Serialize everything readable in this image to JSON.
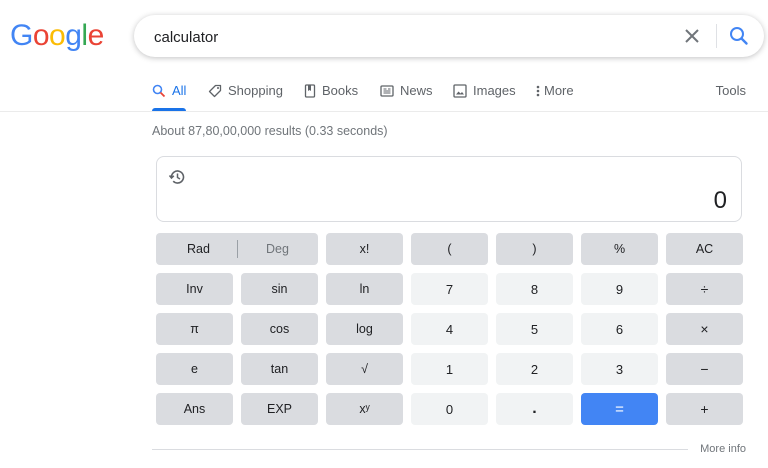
{
  "logo": {
    "letters": [
      "G",
      "o",
      "o",
      "g",
      "l",
      "e"
    ],
    "colors": [
      "#4285f4",
      "#ea4335",
      "#fbbc05",
      "#4285f4",
      "#34a853",
      "#ea4335"
    ]
  },
  "search": {
    "query": "calculator",
    "clear_icon": "close-icon",
    "search_icon": "search-icon"
  },
  "tabs": [
    {
      "label": "All",
      "icon": "search-icon"
    },
    {
      "label": "Shopping",
      "icon": "tag-icon"
    },
    {
      "label": "Books",
      "icon": "book-icon"
    },
    {
      "label": "News",
      "icon": "newspaper-icon"
    },
    {
      "label": "Images",
      "icon": "image-icon"
    },
    {
      "label": "More",
      "icon": "kebab-icon"
    }
  ],
  "tools_label": "Tools",
  "result_stats": "About 87,80,00,000 results (0.33 seconds)",
  "calculator": {
    "display_value": "0",
    "rad": "Rad",
    "deg": "Deg",
    "rows": [
      [
        "x!",
        "(",
        ")",
        "%",
        "AC"
      ],
      [
        "Inv",
        "sin",
        "ln",
        "7",
        "8",
        "9",
        "÷"
      ],
      [
        "π",
        "cos",
        "log",
        "4",
        "5",
        "6",
        "×"
      ],
      [
        "e",
        "tan",
        "√",
        "1",
        "2",
        "3",
        "−"
      ],
      [
        "Ans",
        "EXP",
        "xʸ",
        "0",
        ".",
        "=",
        "+"
      ]
    ]
  },
  "more_info": "More info",
  "colors": {
    "accent": "#1a73e8",
    "equals": "#4285f4",
    "function_key": "#dadce0",
    "number_key": "#f1f3f4"
  }
}
